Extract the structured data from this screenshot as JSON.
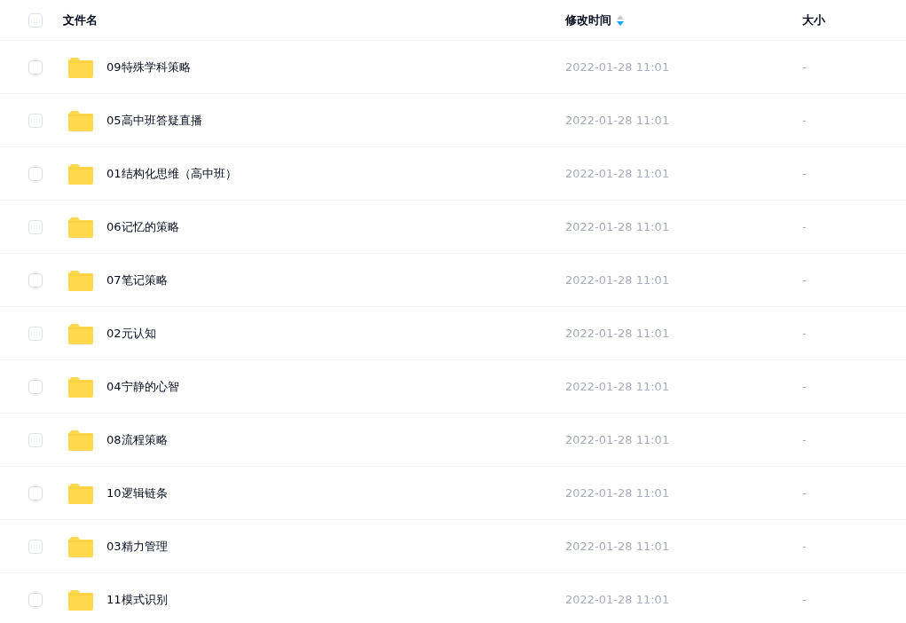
{
  "header": {
    "checked": false,
    "columns": [
      {
        "label": "文件名"
      },
      {
        "label": "修改时间",
        "sorted_descending": true
      },
      {
        "label": "大小"
      }
    ]
  },
  "rows": [
    {
      "kind": "folder",
      "name": "09特殊学科策略",
      "modified": "2022-01-28 11:01",
      "size": "-",
      "checked": false
    },
    {
      "kind": "folder",
      "name": "05高中班答疑直播",
      "modified": "2022-01-28 11:01",
      "size": "-",
      "checked": false
    },
    {
      "kind": "folder",
      "name": "01结构化思维（高中班）",
      "modified": "2022-01-28 11:01",
      "size": "-",
      "checked": false
    },
    {
      "kind": "folder",
      "name": "06记忆的策略",
      "modified": "2022-01-28 11:01",
      "size": "-",
      "checked": false
    },
    {
      "kind": "folder",
      "name": "07笔记策略",
      "modified": "2022-01-28 11:01",
      "size": "-",
      "checked": false
    },
    {
      "kind": "folder",
      "name": "02元认知",
      "modified": "2022-01-28 11:01",
      "size": "-",
      "checked": false
    },
    {
      "kind": "folder",
      "name": "04宁静的心智",
      "modified": "2022-01-28 11:01",
      "size": "-",
      "checked": false
    },
    {
      "kind": "folder",
      "name": "08流程策略",
      "modified": "2022-01-28 11:01",
      "size": "-",
      "checked": false
    },
    {
      "kind": "folder",
      "name": "10逻辑链条",
      "modified": "2022-01-28 11:01",
      "size": "-",
      "checked": false
    },
    {
      "kind": "folder",
      "name": "03精力管理",
      "modified": "2022-01-28 11:01",
      "size": "-",
      "checked": false
    },
    {
      "kind": "folder",
      "name": "11模式识别",
      "modified": "2022-01-28 11:01",
      "size": "-",
      "checked": false
    }
  ]
}
